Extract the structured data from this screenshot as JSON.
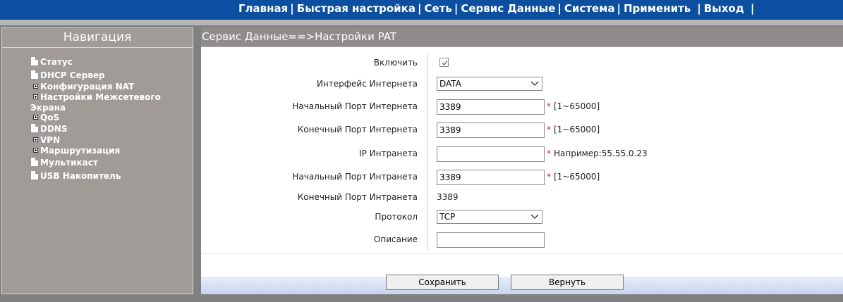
{
  "topnav": {
    "items": [
      "Главная",
      "Быстрая настройка",
      "Сеть",
      "Сервис Данные",
      "Система",
      "Применить",
      "Выход"
    ],
    "separator": "|"
  },
  "nav": {
    "header": "Навигация",
    "items": [
      {
        "label": "Статус",
        "icon": "document-icon"
      },
      {
        "label": "DHCP Сервер",
        "icon": "document-icon"
      },
      {
        "label": "Конфигурация NAT",
        "icon": "plus-expand-icon"
      },
      {
        "label": "Настройки Межсетевого",
        "icon": "plus-expand-icon",
        "continuation": "Экрана"
      },
      {
        "label": "QoS",
        "icon": "plus-expand-icon"
      },
      {
        "label": "DDNS",
        "icon": "document-icon"
      },
      {
        "label": "VPN",
        "icon": "plus-expand-icon"
      },
      {
        "label": "Маршрутизация",
        "icon": "plus-expand-icon"
      },
      {
        "label": "Мультикаст",
        "icon": "document-icon"
      },
      {
        "label": "USB Накопитель",
        "icon": "document-icon"
      }
    ]
  },
  "page": {
    "title": "Сервис Данные==>Настройки PAT"
  },
  "form": {
    "enable_label": "Включить",
    "enable_checked": true,
    "wan_interface_label": "Интерфейс Интернета",
    "wan_interface_value": "DATA",
    "wan_start_port_label": "Начальный Порт Интернета",
    "wan_start_port_value": "3389",
    "wan_start_port_hint": "[1~65000]",
    "wan_end_port_label": "Конечный Порт Интернета",
    "wan_end_port_value": "3389",
    "wan_end_port_hint": "[1~65000]",
    "lan_ip_label": "IP Интранета",
    "lan_ip_value": "",
    "lan_ip_hint": "Например:55.55.0.23",
    "lan_start_port_label": "Начальный Порт Интранета",
    "lan_start_port_value": "3389",
    "lan_start_port_hint": "[1~65000]",
    "lan_end_port_label": "Конечный Порт Интранета",
    "lan_end_port_value": "3389",
    "protocol_label": "Протокол",
    "protocol_value": "TCP",
    "description_label": "Описание",
    "description_value": "",
    "required_marker": "*"
  },
  "buttons": {
    "save": "Сохранить",
    "back": "Вернуть"
  },
  "colors": {
    "topbar": "#0c4fa1",
    "nav_panel": "#a19b98",
    "title_bar": "#8f8c8a",
    "required_star": "#e02020"
  }
}
